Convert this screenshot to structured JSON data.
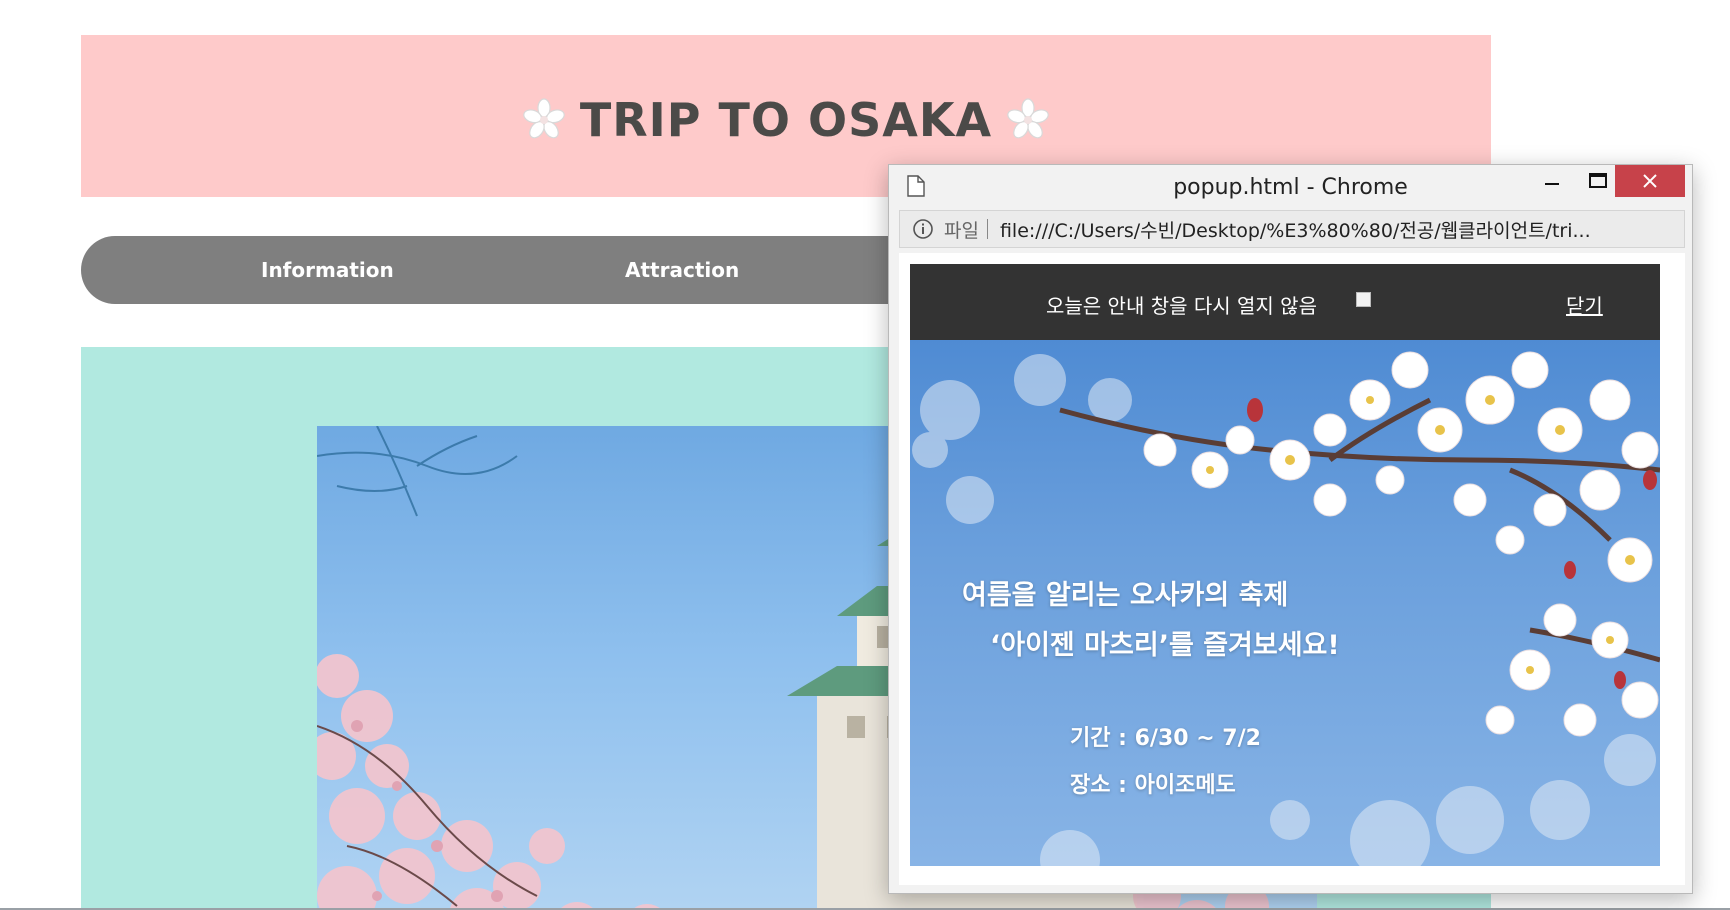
{
  "site": {
    "title": "TRIP TO OSAKA",
    "colors": {
      "header_bg": "#fecaca",
      "nav_bg": "#7f7f7f",
      "content_bg": "#b1e9e0"
    }
  },
  "nav": {
    "items": [
      {
        "label": "Information"
      },
      {
        "label": "Attraction"
      }
    ]
  },
  "content": {
    "image_icon": "osaka-castle-cherry-blossom-photo"
  },
  "popup_window": {
    "title": "popup.html - Chrome",
    "address": {
      "scheme_label": "파일",
      "url": "file:///C:/Users/수빈/Desktop/%E3%80%80/전공/웹클라이언트/tri..."
    },
    "notice": {
      "label": "오늘은 안내 창을 다시 열지 않음",
      "checked": false,
      "close_label": "닫기"
    },
    "banner": {
      "line1": "여름을 알리는 오사카의 축제",
      "line2": "‘아이젠 마츠리’를 즐겨보세요!",
      "period": "기간 : 6/30 ~ 7/2",
      "place": "장소 : 아이조메도"
    },
    "colors": {
      "close_button": "#c7424a",
      "notice_bar": "#333333"
    }
  }
}
